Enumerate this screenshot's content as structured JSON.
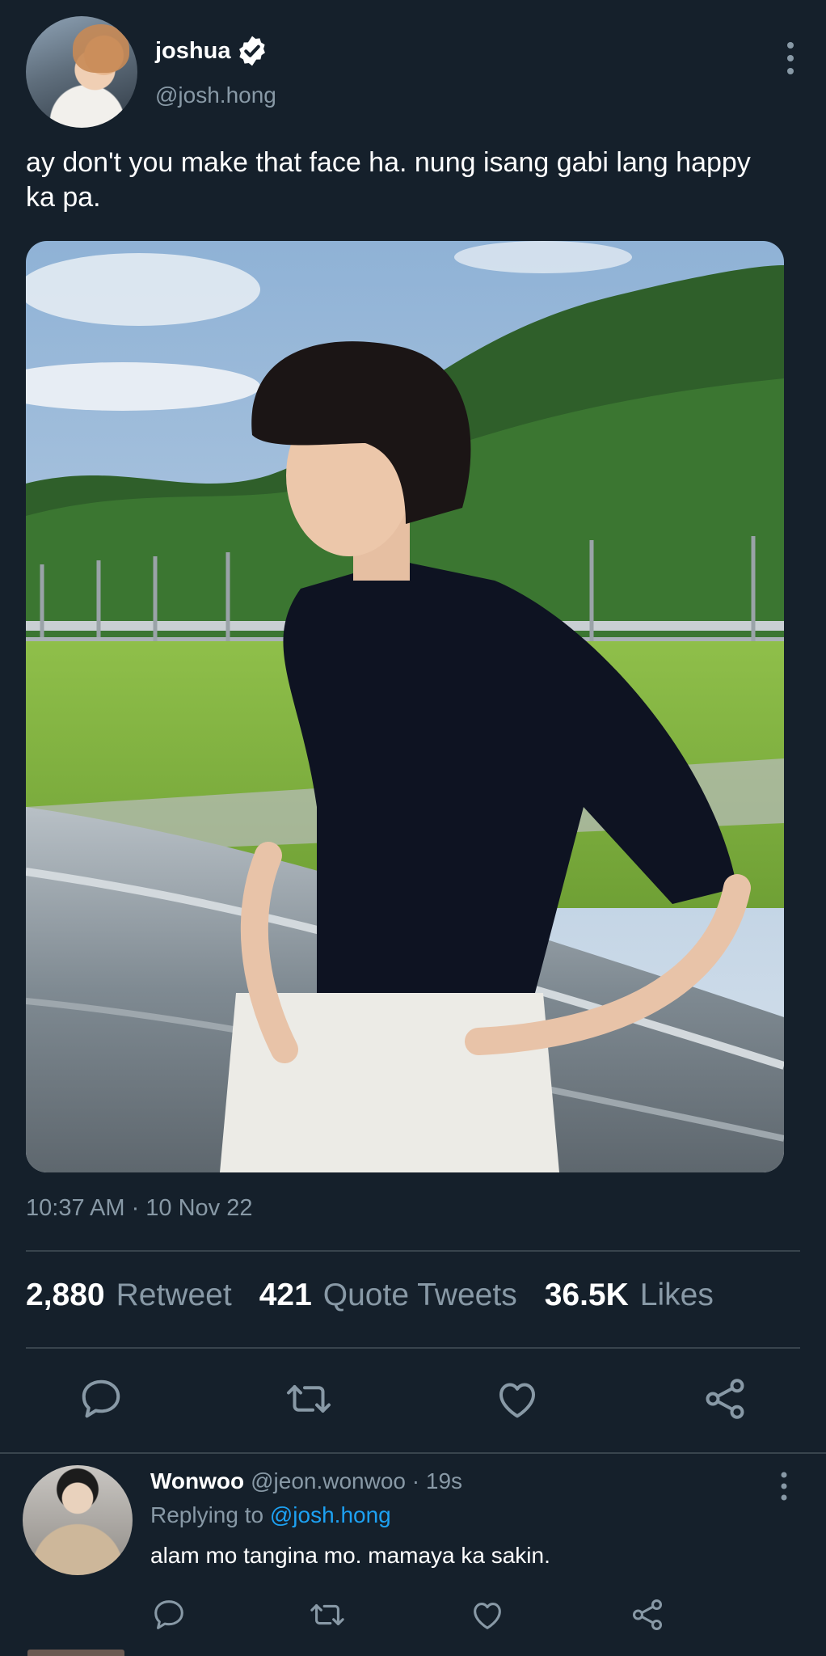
{
  "tweet": {
    "author": {
      "display_name": "joshua",
      "handle": "@josh.hong",
      "verified_icon": "verified-badge-icon"
    },
    "text": "ay don't you make that face ha. nung isang gabi lang happy ka pa.",
    "timestamp": "10:37 AM · 10 Nov 22",
    "stats": {
      "retweets_count": "2,880",
      "retweets_label": "Retweet",
      "quotes_count": "421",
      "quotes_label": "Quote Tweets",
      "likes_count": "36.5K",
      "likes_label": "Likes"
    },
    "actions": [
      "reply-icon",
      "retweet-icon",
      "like-icon",
      "share-icon"
    ]
  },
  "reply": {
    "display_name": "Wonwoo",
    "meta": "@jeon.wonwoo · 19s",
    "replying_prefix": "Replying to",
    "replying_mention": "@josh.hong",
    "text": "alam mo tangina mo. mamaya ka sakin.",
    "actions": [
      "reply-icon",
      "retweet-icon",
      "like-icon",
      "share-icon"
    ]
  },
  "colors": {
    "background": "#15202b",
    "secondary_text": "#8899a6",
    "link": "#1da1f2",
    "divider": "#38444d",
    "icon": "#8899a6"
  }
}
